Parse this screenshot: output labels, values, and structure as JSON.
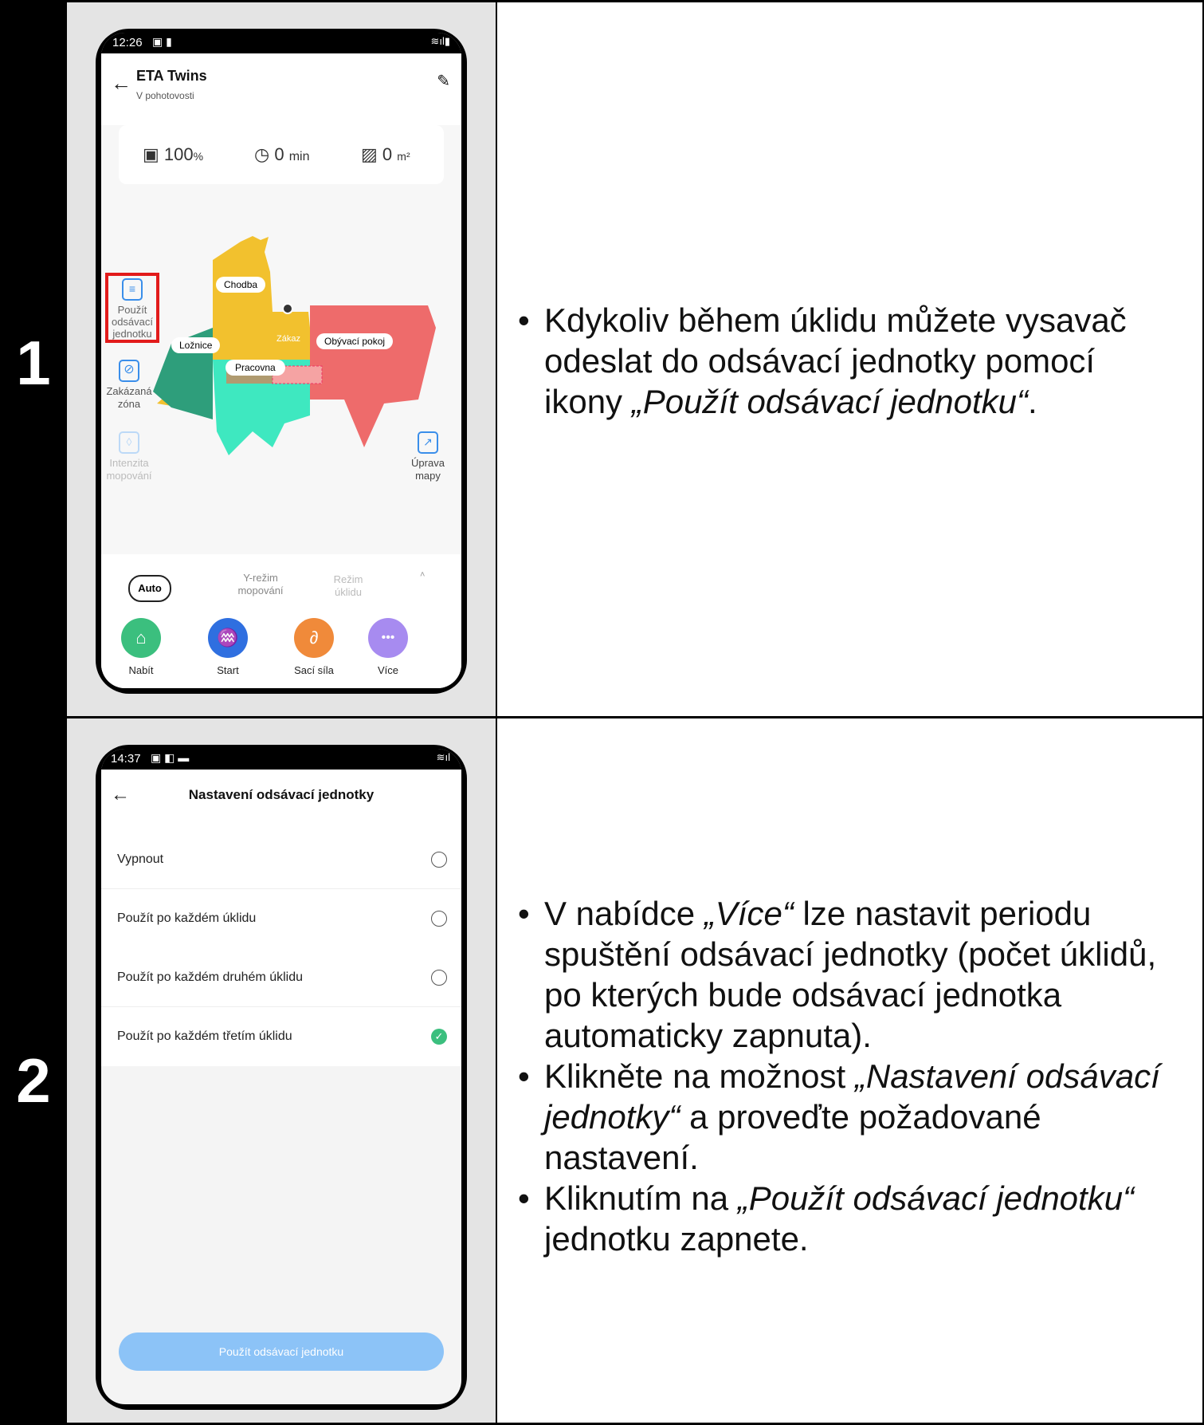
{
  "steps": [
    {
      "number": "1",
      "phone": {
        "time": "12:26",
        "title": "ETA Twins",
        "subtitle": "V pohotovosti",
        "stats": {
          "battery": "100",
          "battery_unit": "%",
          "time": "0",
          "time_unit": "min",
          "area": "0",
          "area_unit": "m²"
        },
        "rooms": {
          "chodba": "Chodba",
          "loznice": "Ložnice",
          "zakaz": "Zákaz",
          "obyvaci": "Obývací pokoj",
          "pracovna": "Pracovna"
        },
        "side_left": {
          "dock_label": "Použít odsávací jednotku",
          "dock_l1": "Použít",
          "dock_l2": "odsávací",
          "dock_l3": "jednotku",
          "zone_l1": "Zakázaná",
          "zone_l2": "zóna",
          "mop_l1": "Intenzita",
          "mop_l2": "mopování"
        },
        "side_right": {
          "edit_l1": "Úprava",
          "edit_l2": "mapy"
        },
        "modes": {
          "auto": "Auto",
          "y_l1": "Y-režim",
          "y_l2": "mopování",
          "clean_l1": "Režim",
          "clean_l2": "úklidu"
        },
        "actions": [
          {
            "label": "Nabít",
            "color": "#3bbf7e",
            "icon": "home-charge-icon"
          },
          {
            "label": "Start",
            "color": "#2f6fe0",
            "icon": "broom-icon"
          },
          {
            "label": "Sací síla",
            "color": "#f08a3a",
            "icon": "suction-icon"
          },
          {
            "label": "Více",
            "color": "#a78bf0",
            "icon": "more-icon"
          }
        ]
      },
      "description_html_parts": {
        "p1": "Kdykoliv během úklidu můžete vysavač odeslat do odsávací jednotky pomocí ikony ",
        "p1_italic": "„Použít odsávací jednotku“",
        "p1_end": "."
      }
    },
    {
      "number": "2",
      "phone": {
        "time": "14:37",
        "title": "Nastavení odsávací jednotky",
        "options": [
          {
            "label": "Vypnout",
            "checked": false
          },
          {
            "label": "Použít po každém úklidu",
            "checked": false
          },
          {
            "label": "Použít po každém druhém úklidu",
            "checked": false
          },
          {
            "label": "Použít po každém třetím úklidu",
            "checked": true
          }
        ],
        "button": "Použít odsávací jednotku"
      },
      "bullets": {
        "b1_a": "V nabídce ",
        "b1_i": "„Více“",
        "b1_b": " lze nastavit periodu spuštění odsávací jednotky (počet úklidů, po kterých bude odsávací jednotka automaticky zapnuta).",
        "b2_a": "Klikněte na možnost ",
        "b2_i": "„Nastavení odsávací jednotky“",
        "b2_b": " a proveďte požadované nastavení.",
        "b3_a": "Kliknutím na ",
        "b3_i": "„Použít odsávací jednotku“",
        "b3_b": " jednotku zapnete."
      }
    }
  ],
  "colors": {
    "accent_red": "#e21b1b",
    "check_green": "#3bbf7e",
    "button_blue": "#8cc3f7"
  }
}
